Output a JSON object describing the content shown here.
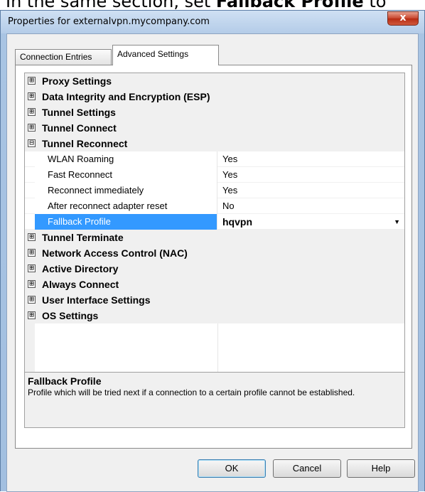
{
  "caption": {
    "prefix": "In the same section, set ",
    "bold": "Fallback Profile",
    "suffix": " to"
  },
  "window": {
    "title": "Properties for externalvpn.mycompany.com",
    "close_label": "x"
  },
  "tabs": [
    {
      "label": "Connection Entries",
      "active": false
    },
    {
      "label": "Advanced Settings",
      "active": true
    }
  ],
  "grid": {
    "categories_before": [
      {
        "sign": "⊞",
        "label": "Proxy Settings"
      },
      {
        "sign": "⊞",
        "label": "Data Integrity and Encryption (ESP)"
      },
      {
        "sign": "⊞",
        "label": "Tunnel Settings"
      },
      {
        "sign": "⊞",
        "label": "Tunnel Connect"
      }
    ],
    "expanded": {
      "sign": "⊟",
      "label": "Tunnel Reconnect"
    },
    "properties": [
      {
        "name": "WLAN Roaming",
        "value": "Yes"
      },
      {
        "name": "Fast Reconnect",
        "value": "Yes"
      },
      {
        "name": "Reconnect immediately",
        "value": "Yes"
      },
      {
        "name": "After reconnect adapter reset",
        "value": "No"
      },
      {
        "name": "Fallback Profile",
        "value": "hqvpn",
        "selected": true
      }
    ],
    "categories_after": [
      {
        "sign": "⊞",
        "label": "Tunnel Terminate"
      },
      {
        "sign": "⊞",
        "label": "Network Access Control (NAC)"
      },
      {
        "sign": "⊞",
        "label": "Active Directory"
      },
      {
        "sign": "⊞",
        "label": "Always Connect"
      },
      {
        "sign": "⊞",
        "label": "User Interface Settings"
      },
      {
        "sign": "⊞",
        "label": "OS Settings"
      }
    ],
    "description": {
      "title": "Fallback Profile",
      "text": "Profile which will be tried next if a connection to a certain profile cannot be established."
    }
  },
  "buttons": {
    "ok": "OK",
    "cancel": "Cancel",
    "help": "Help"
  },
  "colors": {
    "selection": "#3399ff",
    "titlebar": "#b4cce8",
    "close": "#c8452c"
  }
}
